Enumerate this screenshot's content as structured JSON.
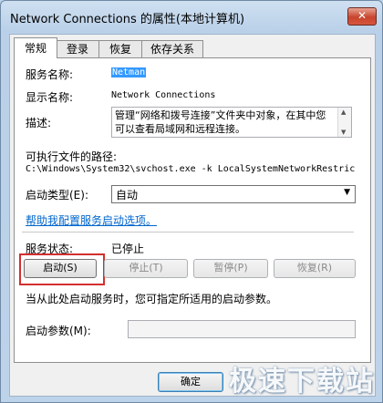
{
  "window": {
    "title": "Network Connections 的属性(本地计算机)",
    "close_glyph": "✕"
  },
  "tabs": [
    {
      "label": "常规",
      "active": true
    },
    {
      "label": "登录",
      "active": false
    },
    {
      "label": "恢复",
      "active": false
    },
    {
      "label": "依存关系",
      "active": false
    }
  ],
  "general": {
    "service_name_label": "服务名称:",
    "service_name_value": "Netman",
    "display_name_label": "显示名称:",
    "display_name_value": "Network Connections",
    "description_label": "描述:",
    "description_text": "管理“网络和拨号连接”文件夹中对象，在其中您可以查看局域网和远程连接。",
    "exe_path_label": "可执行文件的路径:",
    "exe_path_value": "C:\\Windows\\System32\\svchost.exe -k LocalSystemNetworkRestric",
    "startup_type_label": "启动类型(E):",
    "startup_type_value": "自动",
    "help_link": "帮助我配置服务启动选项。",
    "status_label": "服务状态:",
    "status_value": "已停止",
    "start_hint": "当从此处启动服务时，您可指定所适用的启动参数。",
    "start_params_label": "启动参数(M):",
    "start_params_value": ""
  },
  "service_buttons": {
    "start": "启动(S)",
    "stop": "停止(T)",
    "pause": "暂停(P)",
    "resume": "恢复(R)"
  },
  "dialog_buttons": {
    "ok": "确定"
  },
  "watermark": "极速下载站",
  "colors": {
    "link": "#0066cc",
    "selection": "#3399ff",
    "highlight_border": "#d32f2f"
  }
}
